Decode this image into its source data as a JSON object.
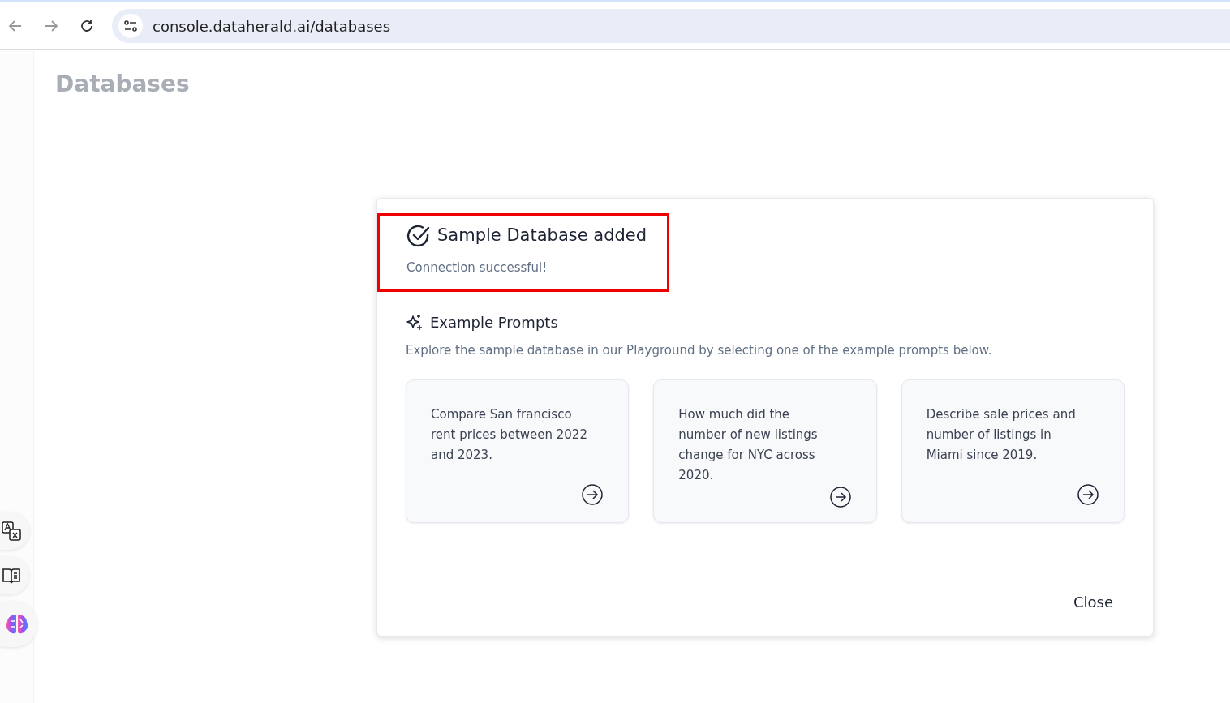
{
  "browser": {
    "url": "console.dataherald.ai/databases"
  },
  "page": {
    "title": "Databases"
  },
  "dialog": {
    "title": "Sample Database added",
    "subtitle": "Connection successful!",
    "highlighted": true,
    "section_title": "Example Prompts",
    "section_description": "Explore the sample database in our Playground by selecting one of the example prompts below.",
    "prompts": [
      {
        "text": "Compare San francisco rent prices between 2022 and 2023."
      },
      {
        "text": "How much did the number of new listings change for NYC across 2020."
      },
      {
        "text": "Describe sale prices and number of listings in Miami since 2019."
      }
    ],
    "close_label": "Close"
  }
}
